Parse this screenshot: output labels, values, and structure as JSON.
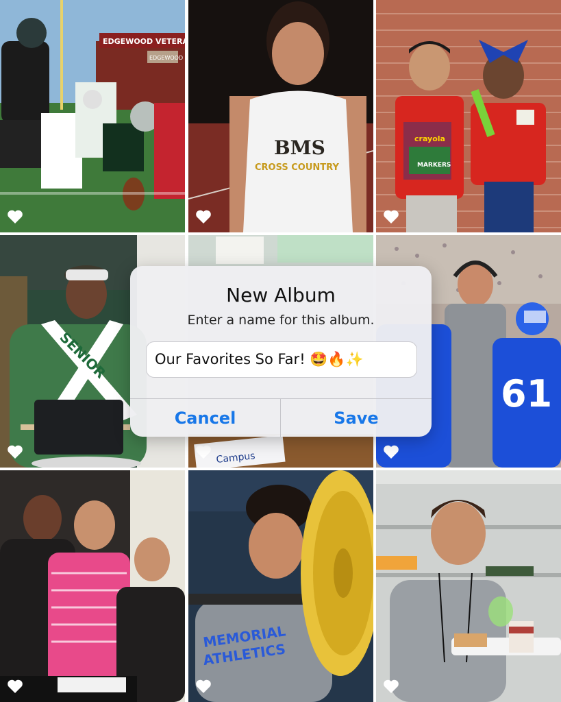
{
  "dialog": {
    "title": "New Album",
    "message": "Enter a name for this album.",
    "input_value": "Our Favorites So Far! 🤩🔥✨",
    "cancel_label": "Cancel",
    "save_label": "Save"
  },
  "photos": [
    {
      "name": "football-players",
      "signs": [
        "EDGEWOOD VETERANS",
        "EDGEWOOD"
      ]
    },
    {
      "name": "cross-country-runner",
      "shirt_text": [
        "BMS",
        "CROSS COUNTRY"
      ]
    },
    {
      "name": "students-with-school-supplies",
      "box_text": [
        "crayola",
        "MARKERS"
      ]
    },
    {
      "name": "drummer-senior-sash",
      "sash_text": "SENIOR"
    },
    {
      "name": "classroom-desk",
      "paper_text": "Campus"
    },
    {
      "name": "coach-with-team",
      "jersey_number": "61"
    },
    {
      "name": "students-group-photo"
    },
    {
      "name": "weightlifter",
      "shirt_text": [
        "MEMORIAL",
        "ATHLETICS"
      ]
    },
    {
      "name": "boy-with-lunch-tray"
    }
  ],
  "colors": {
    "accent": "#1877e8",
    "heart": "#ffffff",
    "dialog_bg": "#eeeef2"
  },
  "icons": {
    "favorite": "heart-icon"
  }
}
